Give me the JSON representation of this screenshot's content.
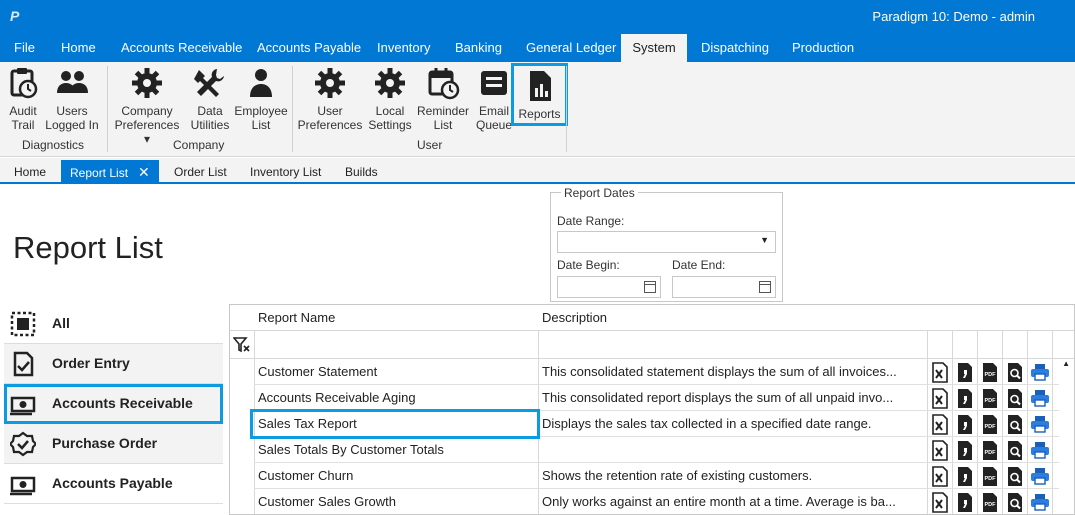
{
  "app": {
    "title": "Paradigm 10: Demo - admin",
    "logo": "P"
  },
  "menu": [
    "File",
    "Home",
    "Accounts Receivable",
    "Accounts Payable",
    "Inventory",
    "Banking",
    "General Ledger",
    "System",
    "Dispatching",
    "Production"
  ],
  "ribbon": {
    "buttons": [
      {
        "line1": "Audit",
        "line2": "Trail",
        "icon": "audit-trail-icon"
      },
      {
        "line1": "Users",
        "line2": "Logged In",
        "icon": "users-icon"
      },
      {
        "line1": "Company",
        "line2": "Preferences ▾",
        "icon": "gear-icon"
      },
      {
        "line1": "Data",
        "line2": "Utilities",
        "icon": "tools-icon"
      },
      {
        "line1": "Employee",
        "line2": "List",
        "icon": "person-icon"
      },
      {
        "line1": "User",
        "line2": "Preferences",
        "icon": "gear-icon"
      },
      {
        "line1": "Local",
        "line2": "Settings",
        "icon": "gear-icon"
      },
      {
        "line1": "Reminder",
        "line2": "List",
        "icon": "calendar-clock-icon"
      },
      {
        "line1": "Email",
        "line2": "Queue",
        "icon": "mail-queue-icon"
      },
      {
        "line1": "Reports",
        "line2": "",
        "icon": "report-chart-icon"
      }
    ],
    "groups": [
      "Diagnostics",
      "Company",
      "User"
    ]
  },
  "tabs": [
    {
      "label": "Home"
    },
    {
      "label": "Report List",
      "close": "✕"
    },
    {
      "label": "Order List"
    },
    {
      "label": "Inventory List"
    },
    {
      "label": "Builds"
    }
  ],
  "page": {
    "title": "Report List"
  },
  "report_dates": {
    "legend": "Report Dates",
    "date_range_label": "Date Range:",
    "date_range_value": "",
    "date_begin_label": "Date Begin:",
    "date_begin_value": "",
    "date_end_label": "Date End:",
    "date_end_value": ""
  },
  "categories": [
    {
      "label": "All",
      "icon": "select-all-icon"
    },
    {
      "label": "Order Entry",
      "icon": "checklist-icon"
    },
    {
      "label": "Accounts Receivable",
      "icon": "money-icon"
    },
    {
      "label": "Purchase Order",
      "icon": "badge-check-icon"
    },
    {
      "label": "Accounts Payable",
      "icon": "money-icon"
    }
  ],
  "grid": {
    "headers": {
      "name": "Report Name",
      "description": "Description"
    },
    "rows": [
      {
        "name": "Customer Statement",
        "description": "This consolidated statement displays the sum of all invoices..."
      },
      {
        "name": "Accounts Receivable Aging",
        "description": "This consolidated report displays the sum of all unpaid invo..."
      },
      {
        "name": "Sales Tax Report",
        "description": "Displays the sales tax collected in a specified date range."
      },
      {
        "name": "Sales Totals By Customer Totals",
        "description": ""
      },
      {
        "name": "Customer Churn",
        "description": "Shows the retention rate of existing customers."
      },
      {
        "name": "Customer Sales Growth",
        "description": "Only works against an entire month at a time. Average is ba..."
      }
    ],
    "actions": [
      "excel-icon",
      "word-icon",
      "pdf-icon",
      "preview-icon",
      "print-icon"
    ]
  },
  "colors": {
    "accent": "#0078d4",
    "highlight": "#0a9be0"
  }
}
